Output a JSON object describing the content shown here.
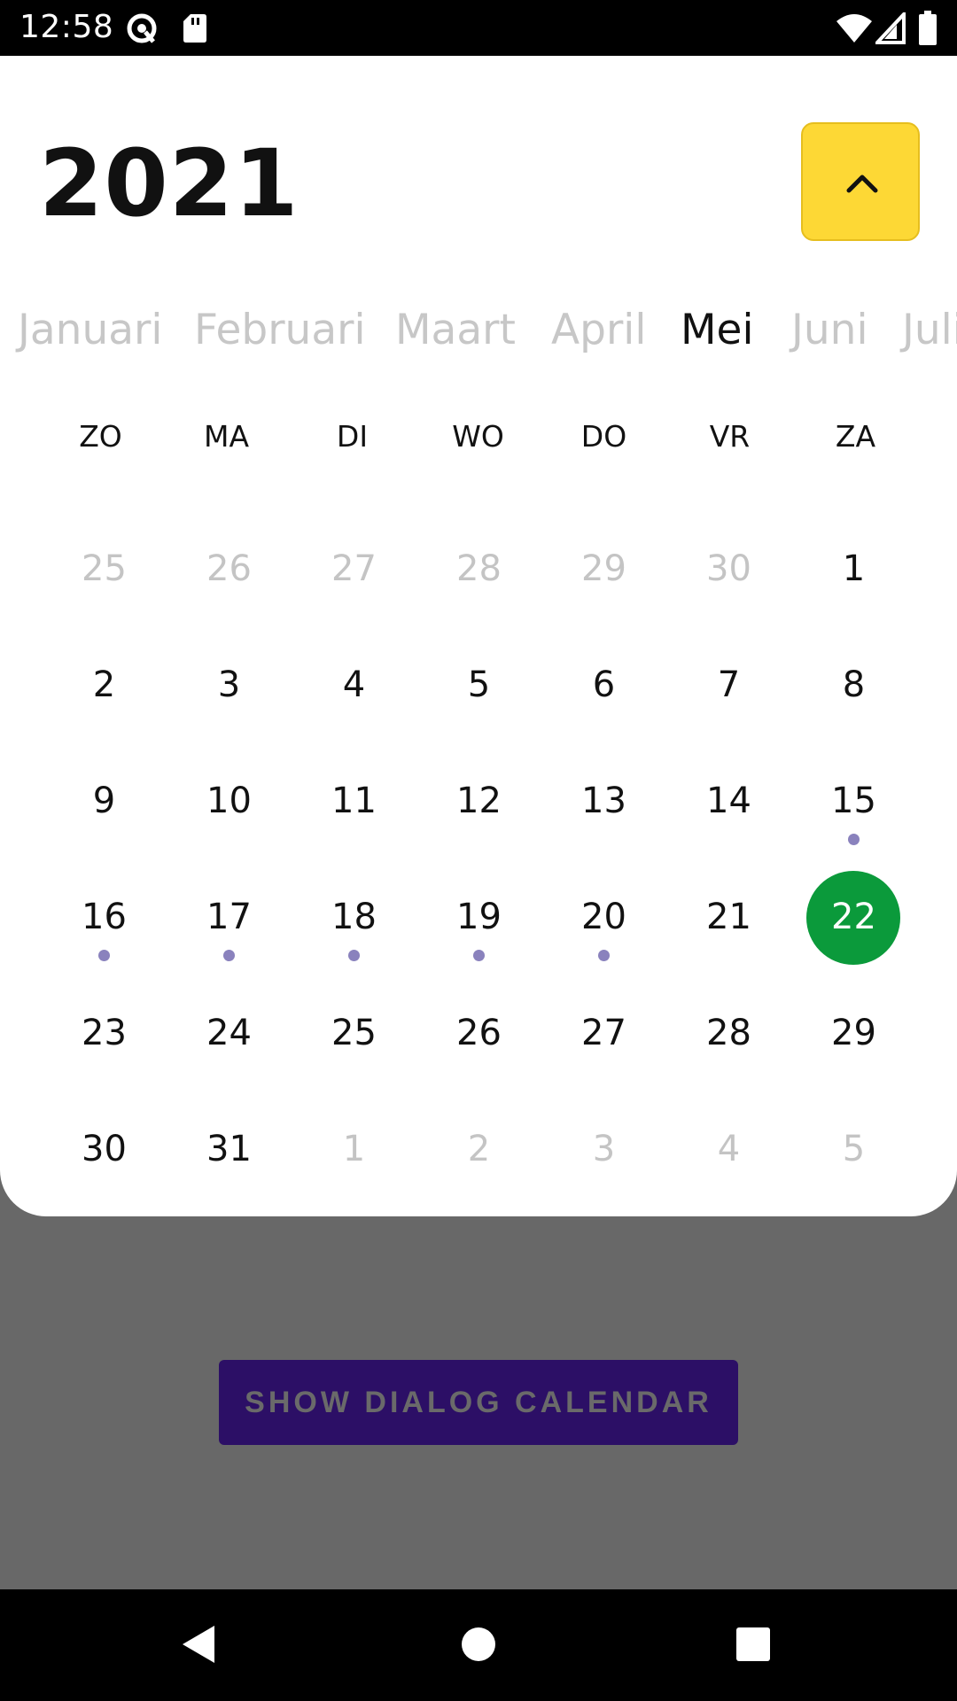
{
  "status_bar": {
    "time": "12:58",
    "icons": [
      "sync-icon",
      "sd-card-icon",
      "wifi-icon",
      "signal-icon",
      "battery-icon"
    ]
  },
  "calendar": {
    "year": "2021",
    "toggle_icon": "chevron-up-icon",
    "accent_color": "#fdd835",
    "selected_color": "#0b9a3b",
    "months": [
      "Januari",
      "Februari",
      "Maart",
      "April",
      "Mei",
      "Juni",
      "Juli"
    ],
    "active_month": "Mei",
    "weekdays": [
      "ZO",
      "MA",
      "DI",
      "WO",
      "DO",
      "VR",
      "ZA"
    ],
    "weeks": [
      [
        {
          "d": "25",
          "muted": true
        },
        {
          "d": "26",
          "muted": true
        },
        {
          "d": "27",
          "muted": true
        },
        {
          "d": "28",
          "muted": true
        },
        {
          "d": "29",
          "muted": true
        },
        {
          "d": "30",
          "muted": true
        },
        {
          "d": "1"
        }
      ],
      [
        {
          "d": "2"
        },
        {
          "d": "3"
        },
        {
          "d": "4"
        },
        {
          "d": "5"
        },
        {
          "d": "6"
        },
        {
          "d": "7"
        },
        {
          "d": "8"
        }
      ],
      [
        {
          "d": "9"
        },
        {
          "d": "10"
        },
        {
          "d": "11"
        },
        {
          "d": "12"
        },
        {
          "d": "13"
        },
        {
          "d": "14"
        },
        {
          "d": "15",
          "event": true
        }
      ],
      [
        {
          "d": "16",
          "event": true
        },
        {
          "d": "17",
          "event": true
        },
        {
          "d": "18",
          "event": true
        },
        {
          "d": "19",
          "event": true
        },
        {
          "d": "20",
          "event": true
        },
        {
          "d": "21"
        },
        {
          "d": "22",
          "selected": true
        }
      ],
      [
        {
          "d": "23"
        },
        {
          "d": "24"
        },
        {
          "d": "25"
        },
        {
          "d": "26"
        },
        {
          "d": "27"
        },
        {
          "d": "28"
        },
        {
          "d": "29"
        }
      ],
      [
        {
          "d": "30"
        },
        {
          "d": "31"
        },
        {
          "d": "1",
          "muted": true
        },
        {
          "d": "2",
          "muted": true
        },
        {
          "d": "3",
          "muted": true
        },
        {
          "d": "4",
          "muted": true
        },
        {
          "d": "5",
          "muted": true
        }
      ]
    ]
  },
  "background": {
    "show_button_label": "SHOW DIALOG CALENDAR"
  },
  "nav_bar": {
    "icons": [
      "back-icon",
      "home-icon",
      "recents-icon"
    ]
  }
}
